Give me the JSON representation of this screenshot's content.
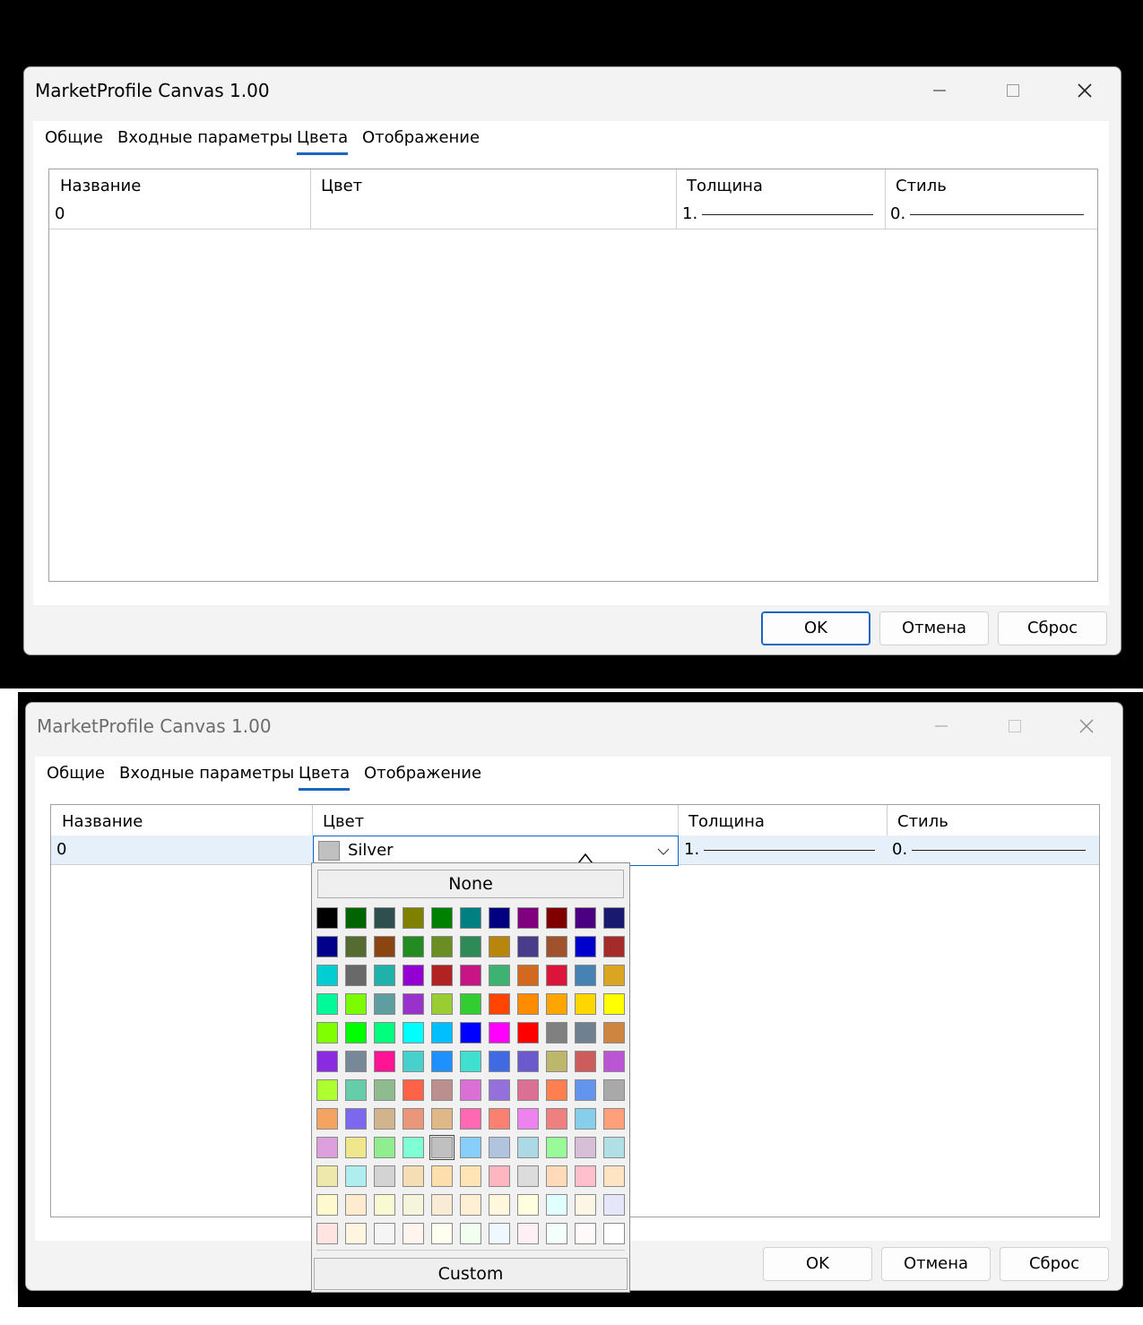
{
  "windows": [
    {
      "title": "MarketProfile Canvas 1.00",
      "tabs": [
        "Общие",
        "Входные параметры",
        "Цвета",
        "Отображение"
      ],
      "active_tab": "Цвета",
      "columns": [
        "Название",
        "Цвет",
        "Толщина",
        "Стиль"
      ],
      "row": {
        "name": "0",
        "color": "",
        "width": "1.",
        "style": "0."
      },
      "buttons": {
        "ok": "OK",
        "cancel": "Отмена",
        "reset": "Сброс"
      }
    },
    {
      "title": "MarketProfile Canvas 1.00",
      "tabs": [
        "Общие",
        "Входные параметры",
        "Цвета",
        "Отображение"
      ],
      "active_tab": "Цвета",
      "columns": [
        "Название",
        "Цвет",
        "Толщина",
        "Стиль"
      ],
      "row": {
        "name": "0",
        "color": "Silver",
        "width": "1.",
        "style": "0."
      },
      "buttons": {
        "ok": "OK",
        "cancel": "Отмена",
        "reset": "Сброс"
      }
    }
  ],
  "color_picker": {
    "none_label": "None",
    "custom_label": "Custom",
    "selected": "#C0C0C0",
    "rows": [
      [
        "#000000",
        "#006400",
        "#2F4F4F",
        "#808000",
        "#008000",
        "#008080",
        "#000080",
        "#800080",
        "#800000",
        "#4B0082",
        "#191970"
      ],
      [
        "#00008B",
        "#556B2F",
        "#8B4513",
        "#228B22",
        "#6B8E23",
        "#2E8B57",
        "#B8860B",
        "#483D8B",
        "#A0522D",
        "#0000CD",
        "#A52A2A"
      ],
      [
        "#00CED1",
        "#696969",
        "#20B2AA",
        "#9400D3",
        "#B22222",
        "#C71585",
        "#3CB371",
        "#D2691E",
        "#DC143C",
        "#4682B4",
        "#DAA520"
      ],
      [
        "#00FA9A",
        "#7CFC00",
        "#5F9EA0",
        "#9932CC",
        "#9ACD32",
        "#32CD32",
        "#FF4500",
        "#FF8C00",
        "#FFA500",
        "#FFD700",
        "#FFFF00"
      ],
      [
        "#7FFF00",
        "#00FF00",
        "#00FF7F",
        "#00FFFF",
        "#00BFFF",
        "#0000FF",
        "#FF00FF",
        "#FF0000",
        "#808080",
        "#708090",
        "#CD853F"
      ],
      [
        "#8A2BE2",
        "#778899",
        "#FF1493",
        "#48D1CC",
        "#1E90FF",
        "#40E0D0",
        "#4169E1",
        "#6A5ACD",
        "#BDB76B",
        "#CD5C5C",
        "#BA55D3"
      ],
      [
        "#ADFF2F",
        "#66CDAA",
        "#8FBC8F",
        "#FF6347",
        "#BC8F8F",
        "#DA70D6",
        "#9370DB",
        "#DB7093",
        "#FF7F50",
        "#6495ED",
        "#A9A9A9"
      ],
      [
        "#F4A460",
        "#7B68EE",
        "#D2B48C",
        "#E9967A",
        "#DEB887",
        "#FF69B4",
        "#FA8072",
        "#EE82EE",
        "#F08080",
        "#87CEEB",
        "#FFA07A"
      ],
      [
        "#DDA0DD",
        "#F0E68C",
        "#90EE90",
        "#7FFFD4",
        "#C0C0C0",
        "#87CEFA",
        "#B0C4DE",
        "#ADD8E6",
        "#98FB98",
        "#D8BFD8",
        "#B0E0E6"
      ],
      [
        "#EEE8AA",
        "#AFEEEE",
        "#D3D3D3",
        "#F5DEB3",
        "#FFDEAD",
        "#FFE4B5",
        "#FFB6C1",
        "#DCDCDC",
        "#FFDAB9",
        "#FFC0CB",
        "#FFE4C4"
      ],
      [
        "#FFFACD",
        "#FFEBCD",
        "#FAFAD2",
        "#F5F5DC",
        "#FAEBD7",
        "#FFEFD5",
        "#FFF8DC",
        "#FFFFE0",
        "#E0FFFF",
        "#FDF5E6",
        "#E6E6FA"
      ],
      [
        "#FFE4E1",
        "#FFF5E1",
        "#F5F5F5",
        "#FFF5EE",
        "#FFFFF0",
        "#F0FFF0",
        "#F0F8FF",
        "#FFF0F5",
        "#F5FFFA",
        "#FFFAFA",
        "#FFFFFF"
      ]
    ]
  }
}
